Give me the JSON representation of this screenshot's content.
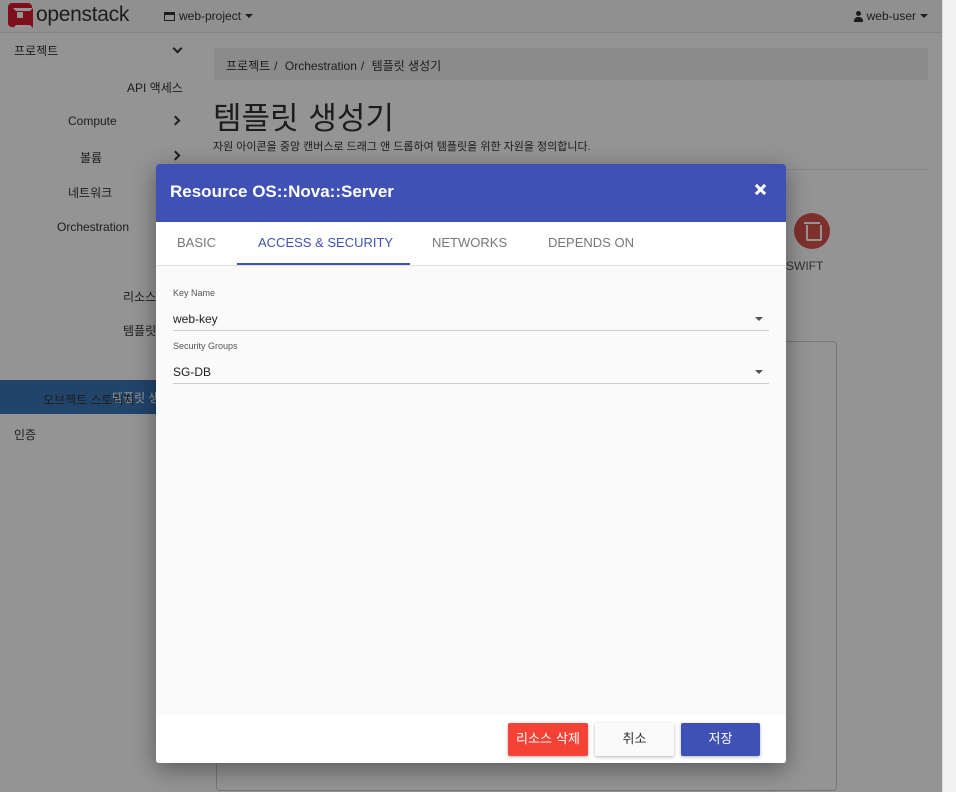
{
  "navbar": {
    "brand": "openstack",
    "project": "web-project",
    "user": "web-user"
  },
  "sidebar": {
    "project_label": "프로젝트",
    "items": [
      {
        "label": "API 액세스"
      },
      {
        "label": "Compute"
      },
      {
        "label": "볼륨"
      },
      {
        "label": "네트워크"
      },
      {
        "label": "Orchestration"
      },
      {
        "label": "리소스"
      },
      {
        "label": "템플릿"
      },
      {
        "label": "템플릿 생"
      },
      {
        "label": "오브젝트 스토리지"
      },
      {
        "label": "인증"
      }
    ]
  },
  "breadcrumb": {
    "items": [
      "프로젝트",
      "Orchestration",
      "템플릿 생성기"
    ],
    "separator": "/"
  },
  "page": {
    "title": "템플릿 생성기",
    "description": "자원 아이콘을 중앙 캔버스로 드래그 앤 드롭하여 템플릿을 위한 자원을 정의합니다.",
    "swift_label": "SWIFT"
  },
  "modal": {
    "title": "Resource OS::Nova::Server",
    "tabs": [
      {
        "label": "BASIC"
      },
      {
        "label": "ACCESS & SECURITY"
      },
      {
        "label": "NETWORKS"
      },
      {
        "label": "DEPENDS ON"
      }
    ],
    "active_tab": "ACCESS & SECURITY",
    "fields": {
      "key_name": {
        "label": "Key Name",
        "value": "web-key"
      },
      "security_groups": {
        "label": "Security Groups",
        "value": "SG-DB"
      }
    },
    "buttons": {
      "delete": "리소스 삭제",
      "cancel": "취소",
      "save": "저장"
    }
  },
  "colors": {
    "primary": "#3f51b5",
    "danger": "#f44336",
    "sidebar_active": "#3a76b8",
    "brand_red": "#da1a32"
  }
}
